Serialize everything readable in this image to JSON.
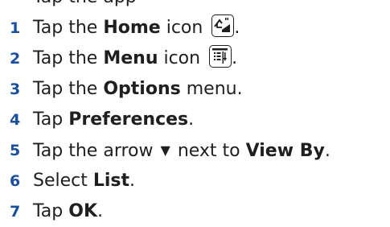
{
  "steps": [
    {
      "number": "",
      "text": "Tap the app",
      "partial": true
    },
    {
      "number": "1",
      "before": "Tap the ",
      "bold": "Home",
      "after": " icon",
      "icon": "home-icon",
      "end": "."
    },
    {
      "number": "2",
      "before": "Tap the ",
      "bold": "Menu",
      "after": " icon",
      "icon": "menu-icon",
      "end": "."
    },
    {
      "number": "3",
      "before": "Tap the ",
      "bold": "Options",
      "after": " menu."
    },
    {
      "number": "4",
      "before": "Tap ",
      "bold": "Preferences",
      "after": "."
    },
    {
      "number": "5",
      "before": "Tap the arrow",
      "arrow": "▼",
      "middle": "next to ",
      "bold": "View By",
      "after": "."
    },
    {
      "number": "6",
      "before": "Select ",
      "bold": "List",
      "after": "."
    },
    {
      "number": "7",
      "before": "Tap ",
      "bold": "OK",
      "after": "."
    }
  ]
}
